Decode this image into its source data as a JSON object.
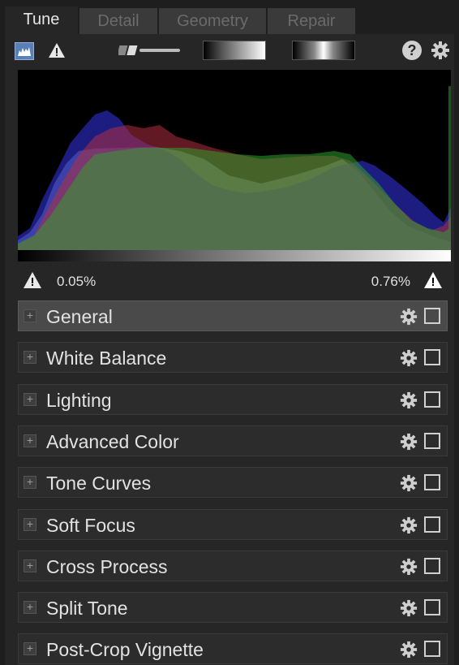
{
  "tabs": [
    {
      "label": "Tune",
      "active": true
    },
    {
      "label": "Detail",
      "active": false
    },
    {
      "label": "Geometry",
      "active": false
    },
    {
      "label": "Repair",
      "active": false
    }
  ],
  "toolbar": {
    "icons": [
      "histogram-icon",
      "warning-icon",
      "slider-icon",
      "gradient-linear-icon",
      "gradient-radial-icon",
      "help-icon",
      "gear-icon"
    ],
    "help_label": "?"
  },
  "histogram": {
    "colors": {
      "red": "#d03030",
      "green": "#30c030",
      "blue": "#2828c0",
      "luma": "#8a9ab0"
    }
  },
  "clipping": {
    "shadow": "0.05%",
    "highlight": "0.76%"
  },
  "sections": [
    {
      "label": "General",
      "active": true
    },
    {
      "label": "White Balance",
      "active": false
    },
    {
      "label": "Lighting",
      "active": false
    },
    {
      "label": "Advanced Color",
      "active": false
    },
    {
      "label": "Tone Curves",
      "active": false
    },
    {
      "label": "Soft Focus",
      "active": false
    },
    {
      "label": "Cross Process",
      "active": false
    },
    {
      "label": "Split Tone",
      "active": false
    },
    {
      "label": "Post-Crop Vignette",
      "active": false
    }
  ]
}
